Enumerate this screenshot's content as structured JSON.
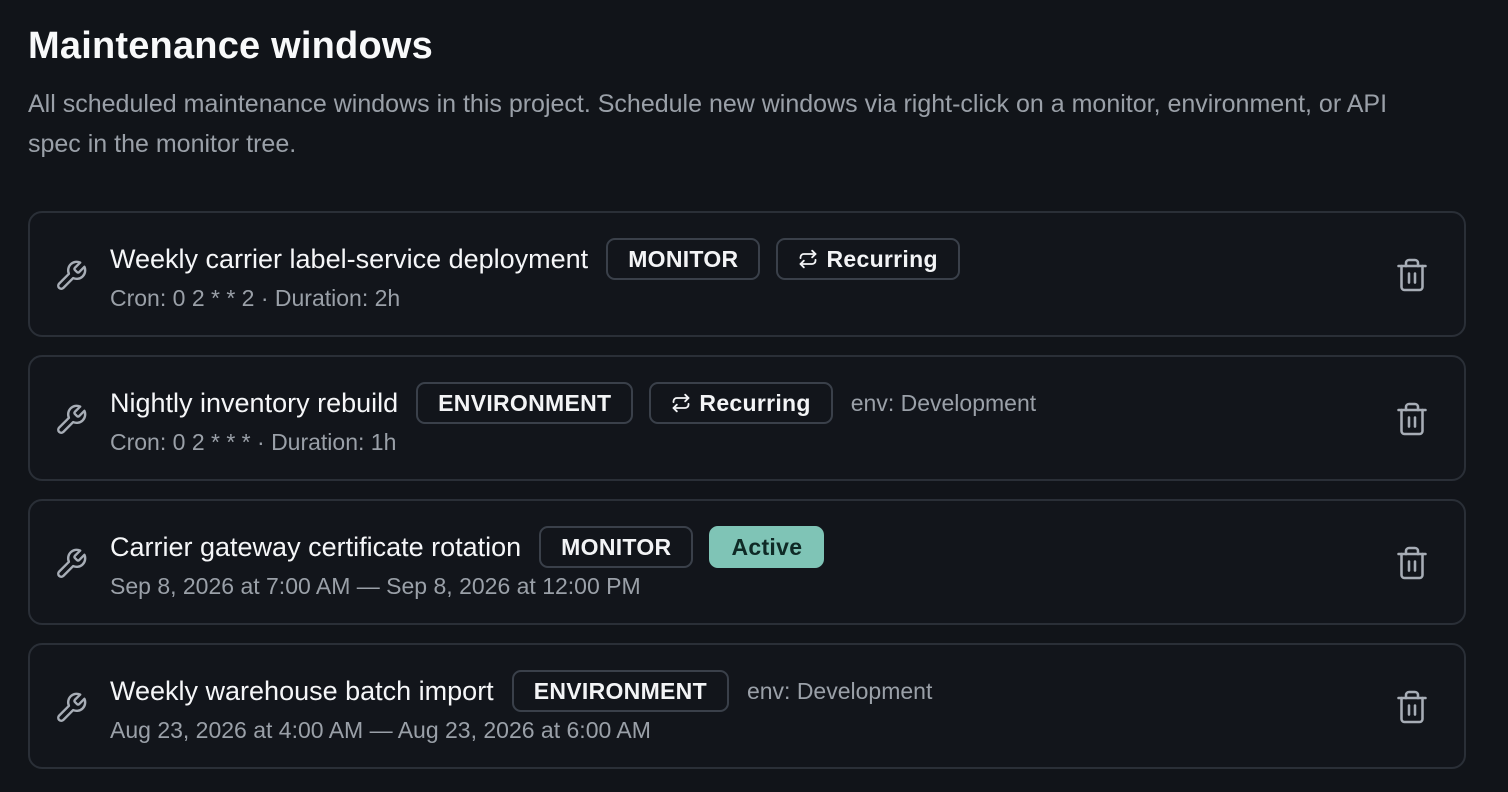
{
  "page": {
    "title": "Maintenance windows",
    "description": "All scheduled maintenance windows in this project. Schedule new windows via right-click on a monitor, environment, or API spec in the monitor tree."
  },
  "colors": {
    "background": "#111419",
    "card_border": "#2a2f37",
    "muted_text": "#9aa0a8",
    "active_badge": "#7fc4b6"
  },
  "windows": [
    {
      "title": "Weekly carrier label-service deployment",
      "scope_badge": "MONITOR",
      "status_badge": "Recurring",
      "env": "",
      "schedule": "Cron: 0 2 * * 2 · Duration: 2h",
      "icon": "wrench-icon",
      "action_icon": "trash-icon"
    },
    {
      "title": "Nightly inventory rebuild",
      "scope_badge": "ENVIRONMENT",
      "status_badge": "Recurring",
      "env": "env: Development",
      "schedule": "Cron: 0 2 * * * · Duration: 1h",
      "icon": "wrench-icon",
      "action_icon": "trash-icon"
    },
    {
      "title": "Carrier gateway certificate rotation",
      "scope_badge": "MONITOR",
      "status_badge": "Active",
      "env": "",
      "schedule": "Sep 8, 2026 at 7:00 AM — Sep 8, 2026 at 12:00 PM",
      "icon": "wrench-icon",
      "action_icon": "trash-icon"
    },
    {
      "title": "Weekly warehouse batch import",
      "scope_badge": "ENVIRONMENT",
      "status_badge": "",
      "env": "env: Development",
      "schedule": "Aug 23, 2026 at 4:00 AM — Aug 23, 2026 at 6:00 AM",
      "icon": "wrench-icon",
      "action_icon": "trash-icon"
    }
  ]
}
